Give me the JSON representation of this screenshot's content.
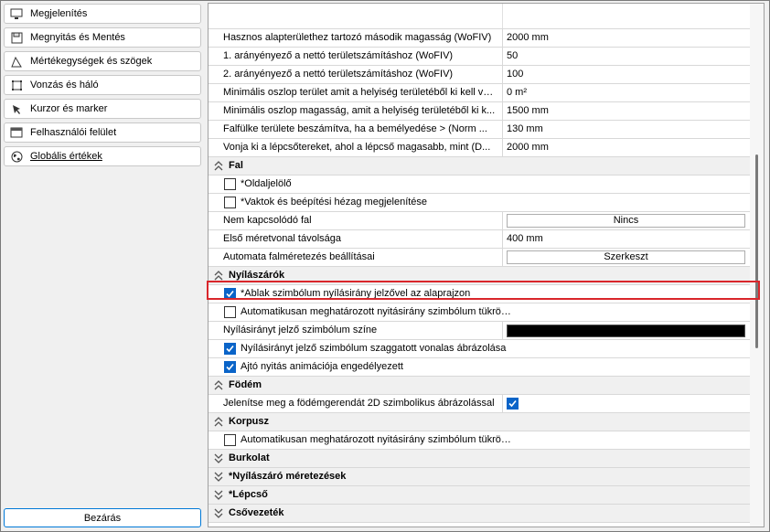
{
  "nav": {
    "items": [
      {
        "label": "Megjelenítés",
        "icon": "monitor-icon"
      },
      {
        "label": "Megnyitás és Mentés",
        "icon": "floppy-icon"
      },
      {
        "label": "Mértékegységek és szögek",
        "icon": "angle-icon"
      },
      {
        "label": "Vonzás és háló",
        "icon": "grid-snap-icon"
      },
      {
        "label": "Kurzor és marker",
        "icon": "cursor-icon"
      },
      {
        "label": "Felhasználói felület",
        "icon": "window-icon"
      },
      {
        "label": "Globális értékek",
        "icon": "globe-icon",
        "active": true
      }
    ],
    "close_label": "Bezárás"
  },
  "grid": {
    "rows": [
      {
        "name": "Hasznos alapterülethez tartozó második magasság (WoFIV)",
        "value": "2000 mm"
      },
      {
        "name": "1. arányényező a nettó területszámításhoz (WoFIV)",
        "value": "50"
      },
      {
        "name": "2. arányényező a nettó területszámításhoz (WoFIV)",
        "value": "100"
      },
      {
        "name": "Minimális oszlop terület amit a helyiség területéből ki kell vonni:",
        "value": "0 m²"
      },
      {
        "name": "Minimális oszlop magasság, amit a helyiség területéből ki k...",
        "value": "1500 mm"
      },
      {
        "name": "Falfülke területe beszámítva, ha a bemélyedése > (Norm ...",
        "value": "130 mm"
      },
      {
        "name": "Vonja ki a lépcsőtereket, ahol a lépcső magasabb, mint (D...",
        "value": "2000 mm"
      }
    ],
    "fal": {
      "title": "Fal",
      "oldaljelolo": "*Oldaljelölő",
      "vaktok": "*Vaktok és beépítési hézag megjelenítése",
      "nem_kapcsolodo": "Nem kapcsolódó fal",
      "nem_kapcsolodo_value": "Nincs",
      "elso_meretvonal": "Első méretvonal távolsága",
      "elso_meretvonal_value": "400 mm",
      "automata": "Automata falméretezés beállításai",
      "automata_value": "Szerkeszt"
    },
    "nyilaszarok": {
      "title": "Nyílászárók",
      "ablak_szimbolum": "*Ablak szimbólum nyílásirány jelzővel az alaprajzon",
      "automatikusan": "Automatikusan meghatározott nyitásirány szimbólum tükrözése",
      "szin": "Nyílásirányt jelző szimbólum színe",
      "szin_value": "#000000",
      "szaggatott": "Nyílásirányt jelző szimbólum szaggatott vonalas ábrázolása",
      "ajto": "Ajtó nyitás animációja engedélyezett"
    },
    "fodem": {
      "title": "Födém",
      "jelenitse": "Jelenítse meg a födémgerendát 2D szimbolikus ábrázolással"
    },
    "korpusz": {
      "title": "Korpusz",
      "automatikusan": "Automatikusan meghatározott nyitásirány szimbólum tükrözése"
    },
    "burkolat": {
      "title": "Burkolat"
    },
    "nyilaszaro_meretezesek": {
      "title": "*Nyílászáró méretezések"
    },
    "lepcso": {
      "title": "*Lépcső"
    },
    "csovezetek": {
      "title": "Csővezeték"
    }
  },
  "colors": {
    "accent": "#0a64c8",
    "highlight": "#d9262b"
  }
}
